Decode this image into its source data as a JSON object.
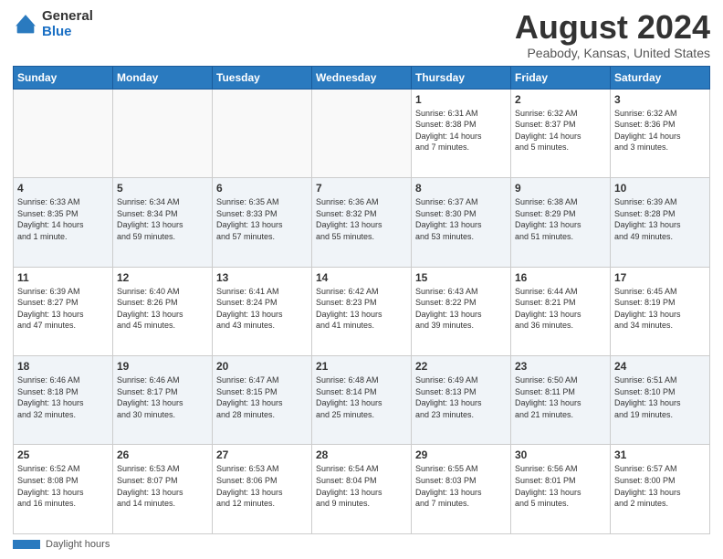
{
  "header": {
    "logo_line1": "General",
    "logo_line2": "Blue",
    "month_title": "August 2024",
    "subtitle": "Peabody, Kansas, United States"
  },
  "days_of_week": [
    "Sunday",
    "Monday",
    "Tuesday",
    "Wednesday",
    "Thursday",
    "Friday",
    "Saturday"
  ],
  "footer": {
    "bar_label": "Daylight hours"
  },
  "weeks": [
    {
      "days": [
        {
          "number": "",
          "info": "",
          "empty": true
        },
        {
          "number": "",
          "info": "",
          "empty": true
        },
        {
          "number": "",
          "info": "",
          "empty": true
        },
        {
          "number": "",
          "info": "",
          "empty": true
        },
        {
          "number": "1",
          "info": "Sunrise: 6:31 AM\nSunset: 8:38 PM\nDaylight: 14 hours\nand 7 minutes.",
          "empty": false
        },
        {
          "number": "2",
          "info": "Sunrise: 6:32 AM\nSunset: 8:37 PM\nDaylight: 14 hours\nand 5 minutes.",
          "empty": false
        },
        {
          "number": "3",
          "info": "Sunrise: 6:32 AM\nSunset: 8:36 PM\nDaylight: 14 hours\nand 3 minutes.",
          "empty": false
        }
      ]
    },
    {
      "days": [
        {
          "number": "4",
          "info": "Sunrise: 6:33 AM\nSunset: 8:35 PM\nDaylight: 14 hours\nand 1 minute.",
          "empty": false
        },
        {
          "number": "5",
          "info": "Sunrise: 6:34 AM\nSunset: 8:34 PM\nDaylight: 13 hours\nand 59 minutes.",
          "empty": false
        },
        {
          "number": "6",
          "info": "Sunrise: 6:35 AM\nSunset: 8:33 PM\nDaylight: 13 hours\nand 57 minutes.",
          "empty": false
        },
        {
          "number": "7",
          "info": "Sunrise: 6:36 AM\nSunset: 8:32 PM\nDaylight: 13 hours\nand 55 minutes.",
          "empty": false
        },
        {
          "number": "8",
          "info": "Sunrise: 6:37 AM\nSunset: 8:30 PM\nDaylight: 13 hours\nand 53 minutes.",
          "empty": false
        },
        {
          "number": "9",
          "info": "Sunrise: 6:38 AM\nSunset: 8:29 PM\nDaylight: 13 hours\nand 51 minutes.",
          "empty": false
        },
        {
          "number": "10",
          "info": "Sunrise: 6:39 AM\nSunset: 8:28 PM\nDaylight: 13 hours\nand 49 minutes.",
          "empty": false
        }
      ]
    },
    {
      "days": [
        {
          "number": "11",
          "info": "Sunrise: 6:39 AM\nSunset: 8:27 PM\nDaylight: 13 hours\nand 47 minutes.",
          "empty": false
        },
        {
          "number": "12",
          "info": "Sunrise: 6:40 AM\nSunset: 8:26 PM\nDaylight: 13 hours\nand 45 minutes.",
          "empty": false
        },
        {
          "number": "13",
          "info": "Sunrise: 6:41 AM\nSunset: 8:24 PM\nDaylight: 13 hours\nand 43 minutes.",
          "empty": false
        },
        {
          "number": "14",
          "info": "Sunrise: 6:42 AM\nSunset: 8:23 PM\nDaylight: 13 hours\nand 41 minutes.",
          "empty": false
        },
        {
          "number": "15",
          "info": "Sunrise: 6:43 AM\nSunset: 8:22 PM\nDaylight: 13 hours\nand 39 minutes.",
          "empty": false
        },
        {
          "number": "16",
          "info": "Sunrise: 6:44 AM\nSunset: 8:21 PM\nDaylight: 13 hours\nand 36 minutes.",
          "empty": false
        },
        {
          "number": "17",
          "info": "Sunrise: 6:45 AM\nSunset: 8:19 PM\nDaylight: 13 hours\nand 34 minutes.",
          "empty": false
        }
      ]
    },
    {
      "days": [
        {
          "number": "18",
          "info": "Sunrise: 6:46 AM\nSunset: 8:18 PM\nDaylight: 13 hours\nand 32 minutes.",
          "empty": false
        },
        {
          "number": "19",
          "info": "Sunrise: 6:46 AM\nSunset: 8:17 PM\nDaylight: 13 hours\nand 30 minutes.",
          "empty": false
        },
        {
          "number": "20",
          "info": "Sunrise: 6:47 AM\nSunset: 8:15 PM\nDaylight: 13 hours\nand 28 minutes.",
          "empty": false
        },
        {
          "number": "21",
          "info": "Sunrise: 6:48 AM\nSunset: 8:14 PM\nDaylight: 13 hours\nand 25 minutes.",
          "empty": false
        },
        {
          "number": "22",
          "info": "Sunrise: 6:49 AM\nSunset: 8:13 PM\nDaylight: 13 hours\nand 23 minutes.",
          "empty": false
        },
        {
          "number": "23",
          "info": "Sunrise: 6:50 AM\nSunset: 8:11 PM\nDaylight: 13 hours\nand 21 minutes.",
          "empty": false
        },
        {
          "number": "24",
          "info": "Sunrise: 6:51 AM\nSunset: 8:10 PM\nDaylight: 13 hours\nand 19 minutes.",
          "empty": false
        }
      ]
    },
    {
      "days": [
        {
          "number": "25",
          "info": "Sunrise: 6:52 AM\nSunset: 8:08 PM\nDaylight: 13 hours\nand 16 minutes.",
          "empty": false
        },
        {
          "number": "26",
          "info": "Sunrise: 6:53 AM\nSunset: 8:07 PM\nDaylight: 13 hours\nand 14 minutes.",
          "empty": false
        },
        {
          "number": "27",
          "info": "Sunrise: 6:53 AM\nSunset: 8:06 PM\nDaylight: 13 hours\nand 12 minutes.",
          "empty": false
        },
        {
          "number": "28",
          "info": "Sunrise: 6:54 AM\nSunset: 8:04 PM\nDaylight: 13 hours\nand 9 minutes.",
          "empty": false
        },
        {
          "number": "29",
          "info": "Sunrise: 6:55 AM\nSunset: 8:03 PM\nDaylight: 13 hours\nand 7 minutes.",
          "empty": false
        },
        {
          "number": "30",
          "info": "Sunrise: 6:56 AM\nSunset: 8:01 PM\nDaylight: 13 hours\nand 5 minutes.",
          "empty": false
        },
        {
          "number": "31",
          "info": "Sunrise: 6:57 AM\nSunset: 8:00 PM\nDaylight: 13 hours\nand 2 minutes.",
          "empty": false
        }
      ]
    }
  ]
}
